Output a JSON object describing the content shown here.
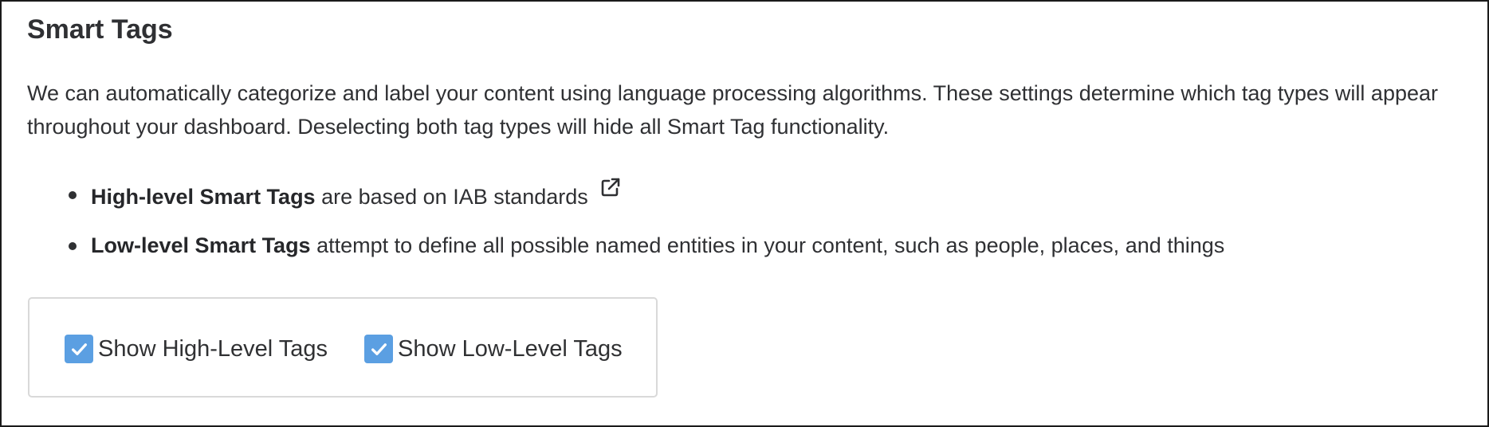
{
  "section": {
    "title": "Smart Tags",
    "description": "We can automatically categorize and label your content using language processing algorithms. These settings determine which tag types will appear throughout your dashboard. Deselecting both tag types will hide all Smart Tag functionality."
  },
  "bullets": [
    {
      "name": "High-level Smart Tags",
      "text": " are based on IAB standards",
      "icon": "external-link-icon"
    },
    {
      "name": "Low-level Smart Tags",
      "text": " attempt to define all possible named entities in your content, such as people, places, and things"
    }
  ],
  "options": [
    {
      "label": "Show High-Level Tags",
      "checked": true
    },
    {
      "label": "Show Low-Level Tags",
      "checked": true
    }
  ],
  "colors": {
    "checkbox": "#5b9fe2",
    "text": "#2f3033",
    "border": "#d9d9d9"
  }
}
